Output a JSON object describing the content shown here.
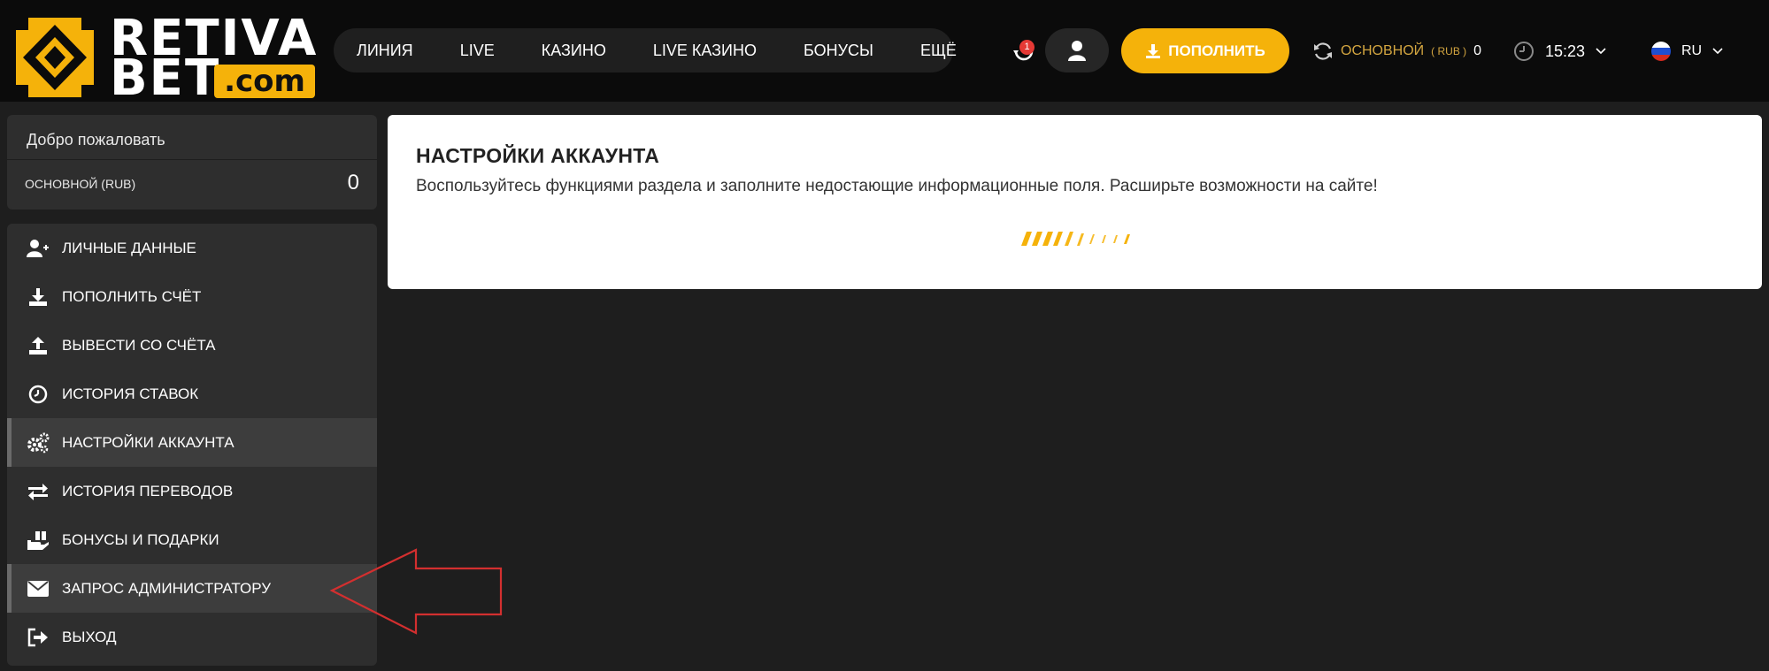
{
  "header": {
    "logo": {
      "line1": "RETIVA",
      "line2": "BET",
      "suffix": ".com"
    },
    "nav": [
      "ЛИНИЯ",
      "LIVE",
      "КАЗИНО",
      "LIVE КАЗИНО",
      "БОНУСЫ",
      "ЕЩЁ"
    ],
    "notifications_count": "1",
    "deposit_label": "ПОПОЛНИТЬ",
    "balance_label": "ОСНОВНОЙ",
    "balance_currency": "( RUB )",
    "balance_value": "0",
    "time": "15:23",
    "language": "RU"
  },
  "sidebar": {
    "welcome": "Добро пожаловать",
    "account_label": "ОСНОВНОЙ (RUB)",
    "account_value": "0",
    "menu": [
      {
        "label": "ЛИЧНЫЕ ДАННЫЕ",
        "icon": "user-plus-icon"
      },
      {
        "label": "ПОПОЛНИТЬ СЧЁТ",
        "icon": "download-icon"
      },
      {
        "label": "ВЫВЕСТИ СО СЧЁТА",
        "icon": "upload-icon"
      },
      {
        "label": "ИСТОРИЯ СТАВОК",
        "icon": "clock-icon"
      },
      {
        "label": "НАСТРОЙКИ АККАУНТА",
        "icon": "gears-icon",
        "active": true
      },
      {
        "label": "ИСТОРИЯ ПЕРЕВОДОВ",
        "icon": "transfer-arrows-icon"
      },
      {
        "label": "БОНУСЫ И ПОДАРКИ",
        "icon": "gift-hand-icon"
      },
      {
        "label": "ЗАПРОС АДМИНИСТРАТОРУ",
        "icon": "envelope-icon",
        "highlighted": true
      },
      {
        "label": "ВЫХОД",
        "icon": "sign-out-icon"
      }
    ]
  },
  "main": {
    "title": "НАСТРОЙКИ АККАУНТА",
    "subtitle": "Воспользуйтесь функциями раздела и заполните недостающие информационные поля. Расширьте возможности на сайте!"
  },
  "colors": {
    "accent": "#f5b20a",
    "header_bg": "#0b0b0b",
    "page_bg": "#1e1e1e",
    "panel_bg": "#2e2e2e",
    "annotation_arrow": "#d32f2f"
  }
}
